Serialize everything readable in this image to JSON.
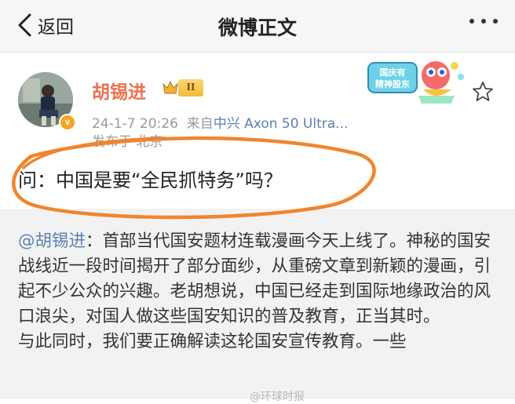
{
  "nav": {
    "back_label": "返回",
    "title": "微博正文"
  },
  "post": {
    "author": "胡锡进",
    "level": "II",
    "date": "24-1-7 20:26",
    "source_prefix": "来自",
    "device": "中兴 Axon 50 Ultra...",
    "location": "发布于 北京",
    "text": "问：中国是要“全民抓特务”吗？",
    "verified_icon": "v",
    "festival_badge_label": "国庆有精神股东"
  },
  "repost": {
    "mention": "@胡锡进",
    "lines": [
      "：首部当代国安题材连载漫画今天上线了。神秘的国安战线近一段时间揭开了部分面纱，从重磅文章到新颖的漫画，引起不少公众的兴趣。老胡想说，中国已经走到国际地缘政治的风口浪尖，对国人做这些国安知识的普及教育，正当其时。",
      "与此同时，我们要正确解读这轮国安宣传教育。一些"
    ]
  },
  "watermark": "@环球时报",
  "colors": {
    "username": "#eb7350",
    "link": "#5b7fb5",
    "annotation": "#f0852d",
    "repost_bg": "#f2f2f2"
  },
  "icons": {
    "back": "chevron-left-icon",
    "more": "more-dots-icon",
    "star": "star-icon",
    "crown": "crown-icon"
  }
}
